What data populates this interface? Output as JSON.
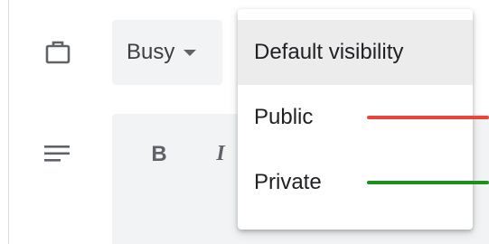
{
  "availability": {
    "selected": "Busy",
    "icon": "briefcase-icon"
  },
  "description": {
    "icon": "notes-icon",
    "bold_label": "B",
    "italic_label": "I"
  },
  "visibility_menu": {
    "items": [
      {
        "label": "Default visibility",
        "highlighted": true
      },
      {
        "label": "Public",
        "indicator_color": "#e8453c"
      },
      {
        "label": "Private",
        "indicator_color": "#1e8e1e"
      }
    ]
  },
  "colors": {
    "field_background": "#f1f3f4",
    "menu_highlight": "#ececec",
    "icon": "#5f6368",
    "text": "#202124"
  }
}
